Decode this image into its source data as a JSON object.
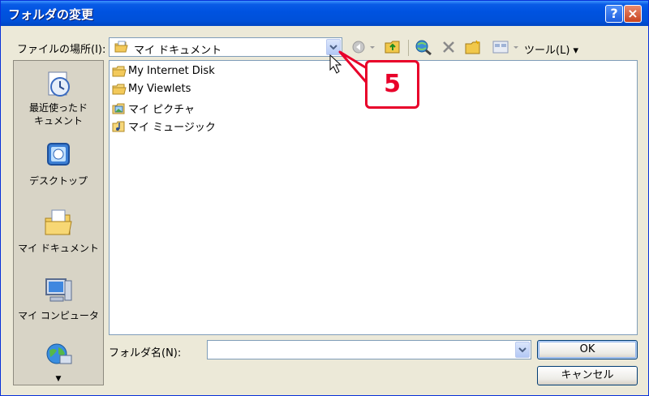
{
  "window": {
    "title": "フォルダの変更"
  },
  "titlebar": {
    "help_label": "?",
    "close_label": "×"
  },
  "location": {
    "label": "ファイルの場所(I):",
    "value": "マイ ドキュメント"
  },
  "toolbar": {
    "tools_label": "ツール(L) ▾"
  },
  "places": [
    {
      "label": "最近使ったド\nキュメント",
      "icon": "recent-documents-icon"
    },
    {
      "label": "デスクトップ",
      "icon": "desktop-icon"
    },
    {
      "label": "マイ ドキュメント",
      "icon": "my-documents-icon"
    },
    {
      "label": "マイ コンピュータ",
      "icon": "my-computer-icon"
    },
    {
      "label": "",
      "icon": "my-network-icon"
    }
  ],
  "files": [
    {
      "name": "My Internet Disk",
      "icon": "folder-icon"
    },
    {
      "name": "My Viewlets",
      "icon": "folder-icon"
    },
    {
      "name": "マイ ピクチャ",
      "icon": "my-pictures-folder-icon"
    },
    {
      "name": "マイ ミュージック",
      "icon": "my-music-folder-icon"
    }
  ],
  "folder_name": {
    "label": "フォルダ名(N):",
    "value": ""
  },
  "buttons": {
    "ok": "OK",
    "cancel": "キャンセル"
  },
  "annotation": {
    "step": "5",
    "color": "#e8002a"
  }
}
